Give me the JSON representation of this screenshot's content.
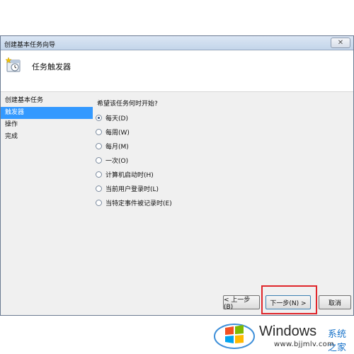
{
  "window": {
    "title": "创建基本任务向导",
    "close_label": "✕"
  },
  "header": {
    "heading": "任务触发器",
    "icon": "task-wizard-icon"
  },
  "nav": {
    "items": [
      {
        "label": "创建基本任务",
        "selected": false
      },
      {
        "label": "触发器",
        "selected": true
      },
      {
        "label": "操作",
        "selected": false
      },
      {
        "label": "完成",
        "selected": false
      }
    ]
  },
  "content": {
    "question": "希望该任务何时开始?",
    "options": [
      {
        "label": "每天(D)",
        "checked": true
      },
      {
        "label": "每周(W)",
        "checked": false
      },
      {
        "label": "每月(M)",
        "checked": false
      },
      {
        "label": "一次(O)",
        "checked": false
      },
      {
        "label": "计算机启动时(H)",
        "checked": false
      },
      {
        "label": "当前用户登录时(L)",
        "checked": false
      },
      {
        "label": "当特定事件被记录时(E)",
        "checked": false
      }
    ]
  },
  "buttons": {
    "back": "< 上一步(B)",
    "next": "下一步(N) >",
    "cancel": "取消"
  },
  "watermark": {
    "brand": "Windows",
    "brand_cn": "系统之家",
    "url": "www.bjjmlv.com"
  },
  "colors": {
    "selection": "#3399ff",
    "highlight": "#e0262b",
    "brand_blue": "#1672c9"
  }
}
